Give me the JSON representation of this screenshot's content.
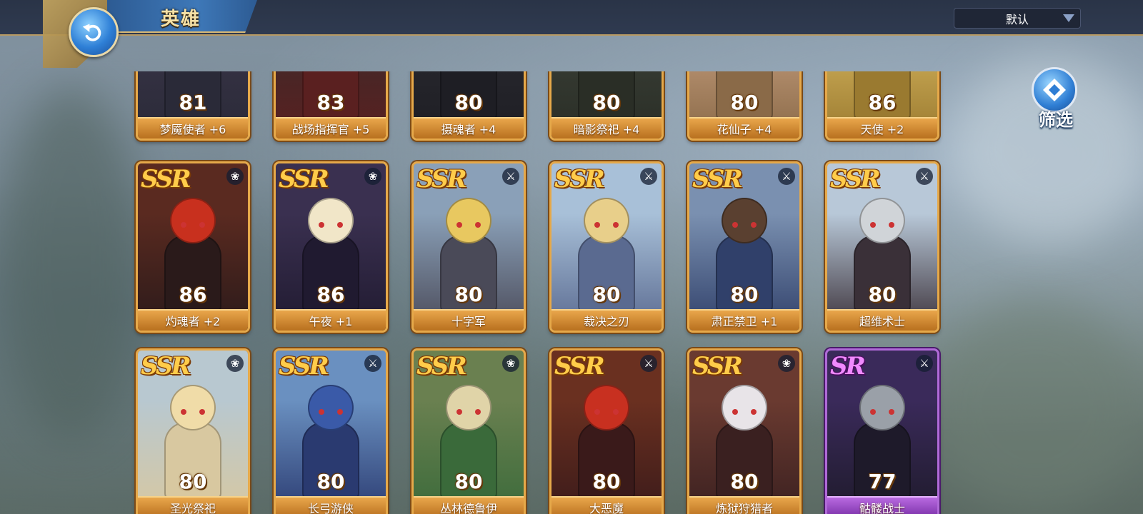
{
  "header": {
    "title": "英雄",
    "sort_label": "默认"
  },
  "filter": {
    "label": "筛选"
  },
  "heroes": [
    {
      "rarity": "",
      "level": "81",
      "name": "梦魇使者 +6",
      "cls": ""
    },
    {
      "rarity": "",
      "level": "83",
      "name": "战场指挥官 +5",
      "cls": ""
    },
    {
      "rarity": "",
      "level": "80",
      "name": "摄魂者 +4",
      "cls": ""
    },
    {
      "rarity": "",
      "level": "80",
      "name": "暗影祭祀 +4",
      "cls": ""
    },
    {
      "rarity": "",
      "level": "80",
      "name": "花仙子 +4",
      "cls": ""
    },
    {
      "rarity": "",
      "level": "86",
      "name": "天使 +2",
      "cls": ""
    },
    {
      "rarity": "SSR",
      "level": "86",
      "name": "灼魂者 +2",
      "cls": "staff"
    },
    {
      "rarity": "SSR",
      "level": "86",
      "name": "午夜 +1",
      "cls": "staff"
    },
    {
      "rarity": "SSR",
      "level": "80",
      "name": "十字军",
      "cls": "swords"
    },
    {
      "rarity": "SSR",
      "level": "80",
      "name": "裁决之刃",
      "cls": "swords"
    },
    {
      "rarity": "SSR",
      "level": "80",
      "name": "肃正禁卫 +1",
      "cls": "swords"
    },
    {
      "rarity": "SSR",
      "level": "80",
      "name": "超维术士",
      "cls": "swords"
    },
    {
      "rarity": "SSR",
      "level": "80",
      "name": "圣光祭祀",
      "cls": "staff"
    },
    {
      "rarity": "SSR",
      "level": "80",
      "name": "长弓游侠",
      "cls": "swords"
    },
    {
      "rarity": "SSR",
      "level": "80",
      "name": "丛林德鲁伊",
      "cls": "staff"
    },
    {
      "rarity": "SSR",
      "level": "80",
      "name": "大恶魔",
      "cls": "swords"
    },
    {
      "rarity": "SSR",
      "level": "80",
      "name": "炼狱狩猎者",
      "cls": "staff"
    },
    {
      "rarity": "SR",
      "level": "77",
      "name": "骷髅战士",
      "cls": "swords"
    }
  ],
  "colors": {
    "ssr_border": "#e6a94a",
    "sr_border": "#b06ad8",
    "accent_blue": "#2e7fd6"
  }
}
